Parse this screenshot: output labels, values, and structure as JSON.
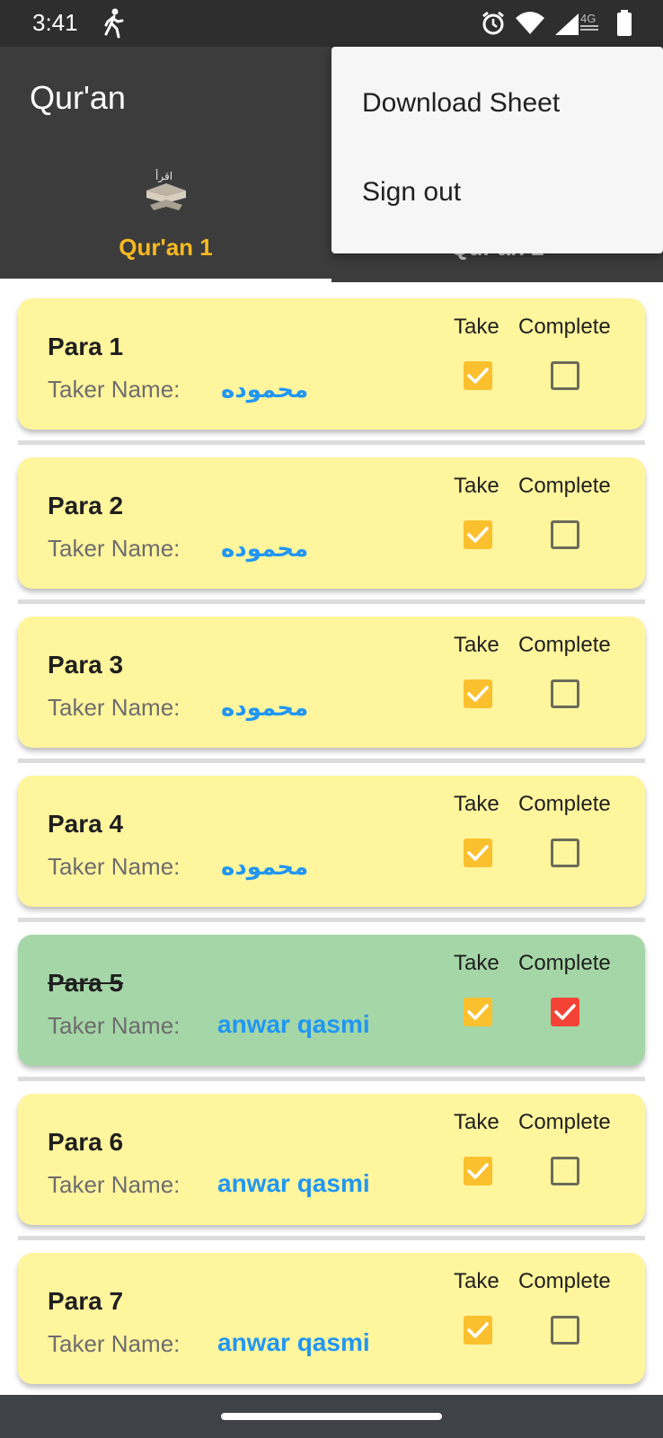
{
  "status_bar": {
    "time": "3:41",
    "network": "4G",
    "icons": [
      "walk-icon",
      "alarm-icon",
      "wifi-icon",
      "signal-icon",
      "battery-icon"
    ]
  },
  "app_bar": {
    "title": "Qur'an",
    "tabs": [
      {
        "label": "Qur'an 1",
        "icon": "quran-book-icon",
        "selected": true
      },
      {
        "label": "Qur'an 2",
        "icon": "quran-book-icon",
        "selected": false
      }
    ]
  },
  "menu": {
    "items": [
      "Download Sheet",
      "Sign out"
    ]
  },
  "list": {
    "column_take": "Take",
    "column_complete": "Complete",
    "taker_label": "Taker Name:",
    "paras": [
      {
        "title": "Para 1",
        "taker": "محموده",
        "take": true,
        "complete": false
      },
      {
        "title": "Para 2",
        "taker": "محموده",
        "take": true,
        "complete": false
      },
      {
        "title": "Para 3",
        "taker": "محموده",
        "take": true,
        "complete": false
      },
      {
        "title": "Para 4",
        "taker": "محموده",
        "take": true,
        "complete": false
      },
      {
        "title": "Para 5",
        "taker": "anwar qasmi",
        "take": true,
        "complete": true
      },
      {
        "title": "Para 6",
        "taker": "anwar qasmi",
        "take": true,
        "complete": false
      },
      {
        "title": "Para 7",
        "taker": "anwar qasmi",
        "take": true,
        "complete": false
      }
    ]
  },
  "colors": {
    "app_bar": "#3c3c3c",
    "accent": "#f9b921",
    "card_pending": "#fff59d",
    "card_complete": "#a5d6a7",
    "taker_name": "#2196f3",
    "complete_check": "#f44336"
  }
}
